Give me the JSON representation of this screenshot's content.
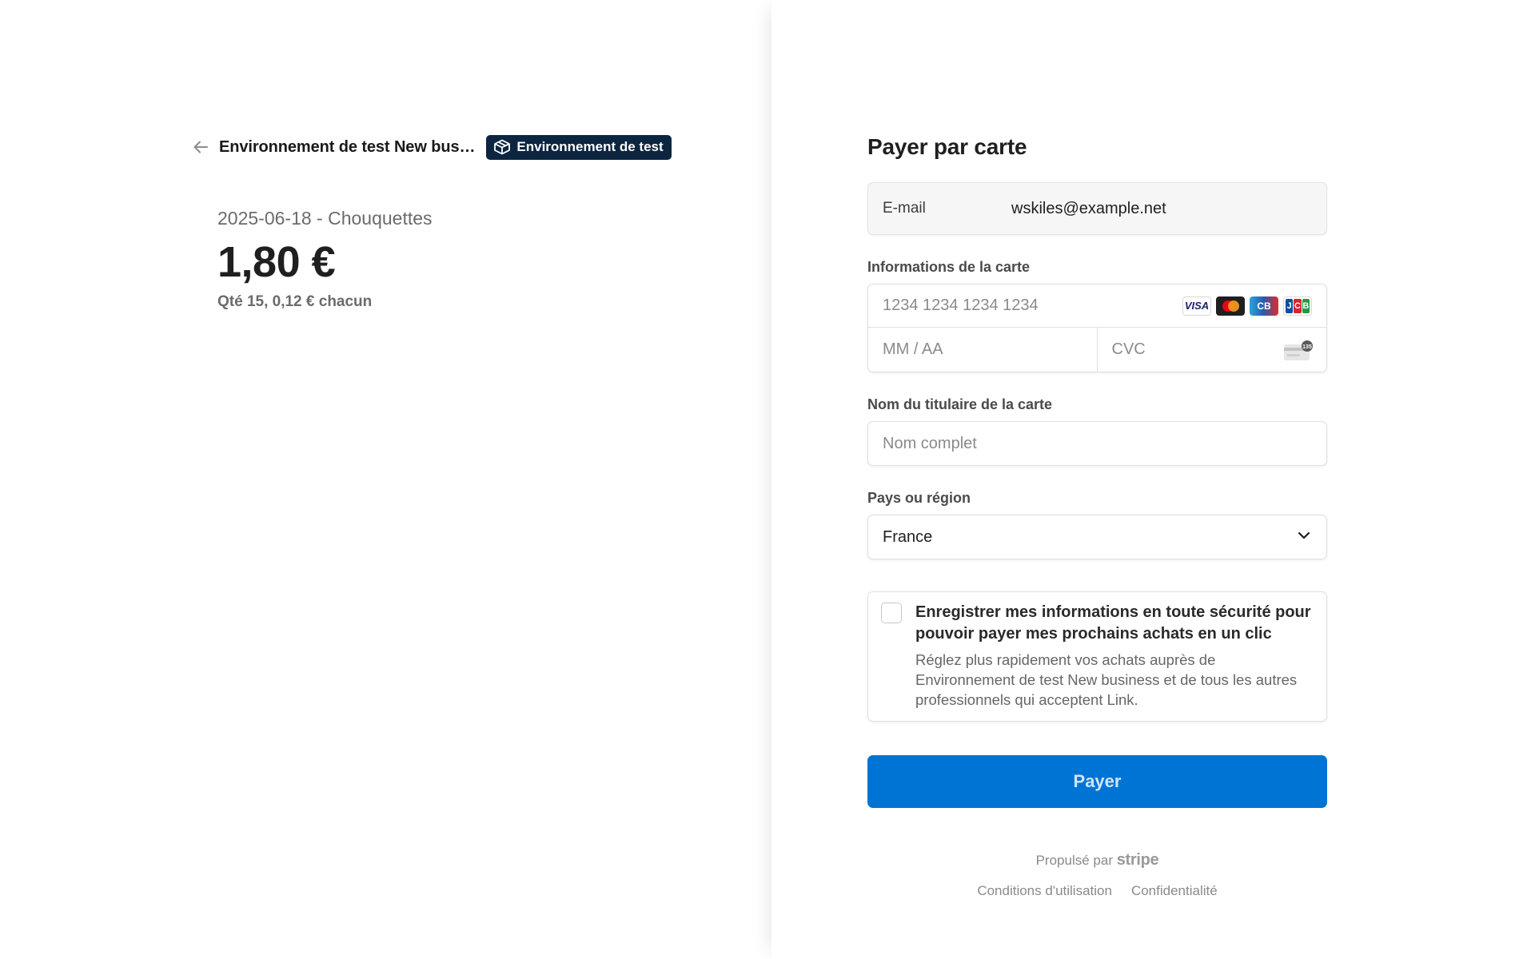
{
  "merchant": {
    "name": "Environnement de test New bus…",
    "test_badge": "Environnement de test"
  },
  "summary": {
    "product_name": "2025-06-18 - Chouquettes",
    "price": "1,80 €",
    "quantity_text": "Qté 15, 0,12 € chacun"
  },
  "form": {
    "title": "Payer par carte",
    "email": {
      "label": "E-mail",
      "value": "wskiles@example.net"
    },
    "card": {
      "label": "Informations de la carte",
      "number_placeholder": "1234 1234 1234 1234",
      "expiry_placeholder": "MM / AA",
      "cvc_placeholder": "CVC",
      "brands": [
        "VISA",
        "mastercard-icon",
        "CB",
        "JCB"
      ],
      "cvc_icon_text": "135"
    },
    "cardholder": {
      "label": "Nom du titulaire de la carte",
      "placeholder": "Nom complet"
    },
    "country": {
      "label": "Pays ou région",
      "selected": "France"
    },
    "save_info": {
      "checked": false,
      "title": "Enregistrer mes informations en toute sécurité pour pouvoir payer mes prochains achats en un clic",
      "description": "Réglez plus rapidement vos achats auprès de Environnement de test New business et de tous les autres professionnels qui acceptent Link."
    },
    "pay_button": "Payer"
  },
  "footer": {
    "powered_by": "Propulsé par",
    "brand": "stripe",
    "links": [
      "Conditions d'utilisation",
      "Confidentialité"
    ]
  },
  "colors": {
    "accent": "#0074d4",
    "badge_bg": "#0c2540"
  }
}
